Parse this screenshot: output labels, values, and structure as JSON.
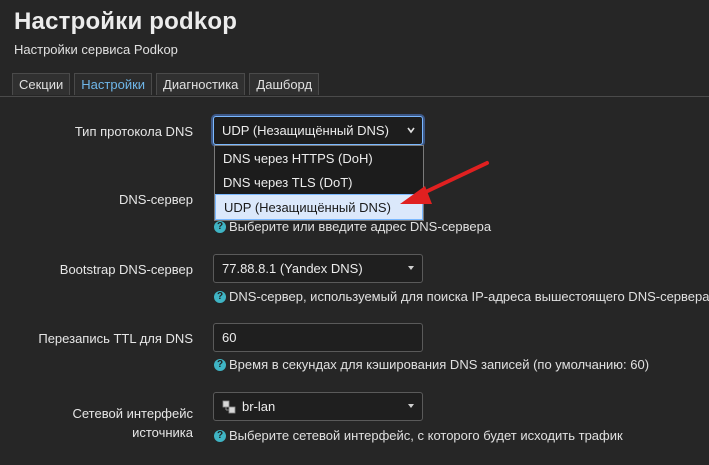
{
  "header": {
    "title": "Настройки podkop",
    "subtitle": "Настройки сервиса Podkop"
  },
  "tabs": [
    {
      "label": "Секции",
      "active": false
    },
    {
      "label": "Настройки",
      "active": true
    },
    {
      "label": "Диагностика",
      "active": false
    },
    {
      "label": "Дашборд",
      "active": false
    }
  ],
  "form": {
    "dns_protocol": {
      "label": "Тип протокола DNS",
      "value": "UDP (Незащищённый DNS)",
      "options": [
        "DNS через HTTPS (DoH)",
        "DNS через TLS (DoT)",
        "UDP (Незащищённый DNS)"
      ],
      "selected_option": "UDP (Незащищённый DNS)"
    },
    "dns_server": {
      "label": "DNS-сервер",
      "hint": "Выберите или введите адрес DNS-сервера"
    },
    "bootstrap_dns": {
      "label": "Bootstrap DNS-сервер",
      "value": "77.88.8.1 (Yandex DNS)",
      "hint": "DNS-сервер, используемый для поиска IP-адреса вышестоящего DNS-сервера"
    },
    "ttl_rewrite": {
      "label": "Перезапись TTL для DNS",
      "value": "60",
      "hint": "Время в секундах для кэширования DNS записей (по умолчанию: 60)"
    },
    "source_interface": {
      "label_line1": "Сетевой интерфейс",
      "label_line2": "источника",
      "value": "br-lan",
      "hint": "Выберите сетевой интерфейс, с которого будет исходить трафик"
    }
  },
  "colors": {
    "accent": "#6fb7ea",
    "arrow": "#e02020",
    "hint_icon": "#3fb4c4"
  }
}
